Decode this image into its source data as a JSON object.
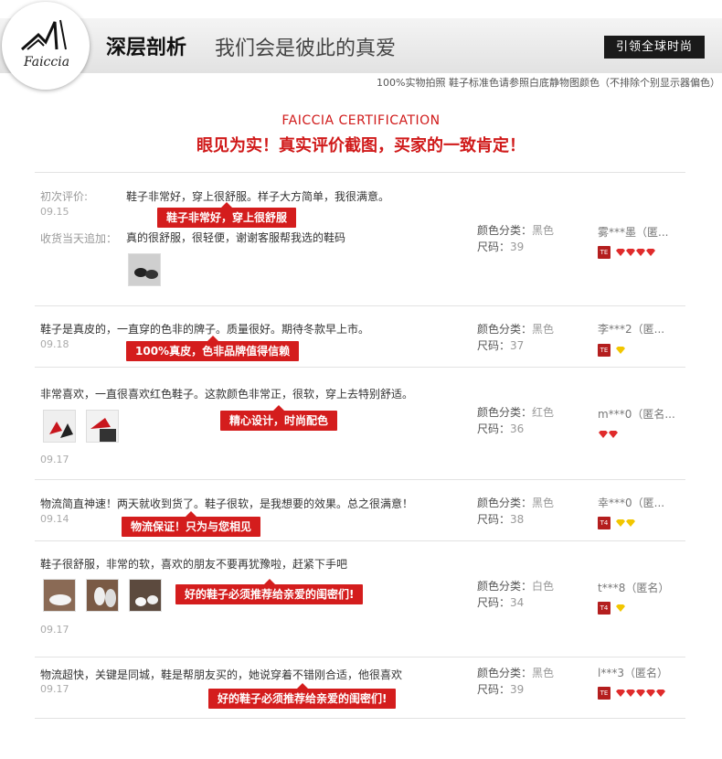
{
  "header": {
    "logo_text": "Faiccia",
    "title": "深层剖析",
    "subtitle": "我们会是彼此的真爱",
    "tag": "引领全球时尚",
    "disclaimer": "100%实物拍照 鞋子标准色请参照白底静物图颜色（不排除个别显示器偏色）"
  },
  "certification": {
    "english": "FAICCIA CERTIFICATION",
    "chinese": "眼见为实！真实评价截图，买家的一致肯定！"
  },
  "attr_labels": {
    "color": "颜色分类：",
    "size": "尺码："
  },
  "colors": {
    "accent_red": "#d41d1d",
    "level_badge": "#b41e1e"
  },
  "reviews": [
    {
      "first_label": "初次评价:",
      "text": "鞋子非常好，穿上很舒服。样子大方简单，我很满意。",
      "date": "09.15",
      "callout": "鞋子非常好，穿上很舒服",
      "followup_label": "收货当天追加：",
      "followup_text": "真的很舒服，很轻便，谢谢客服帮我选的鞋码",
      "color": "黑色",
      "size": "39",
      "user": "雾***墨（匿...",
      "level": "TE",
      "gems": 4
    },
    {
      "text": "鞋子是真皮的，一直穿的色非的牌子。质量很好。期待冬款早上市。",
      "date": "09.18",
      "callout": "100%真皮，色非品牌值得信赖",
      "color": "黑色",
      "size": "37",
      "user": "李***2（匿...",
      "level": "TE",
      "gems": 1
    },
    {
      "text": "非常喜欢，一直很喜欢红色鞋子。这款颜色非常正，很软，穿上去特别舒适。",
      "date": "09.17",
      "callout": "精心设计，时尚配色",
      "color": "红色",
      "size": "36",
      "user": "m***0（匿名...",
      "level": "",
      "gems": 2
    },
    {
      "text": "物流简直神速！两天就收到货了。鞋子很软，是我想要的效果。总之很满意！",
      "date": "09.14",
      "callout": "物流保证！只为与您相见",
      "color": "黑色",
      "size": "38",
      "user": "幸***0（匿...",
      "level": "T4",
      "gems": 2
    },
    {
      "text": "鞋子很舒服，非常的软，喜欢的朋友不要再犹豫啦，赶紧下手吧",
      "date": "09.17",
      "callout": "好的鞋子必须推荐给亲爱的闺密们!",
      "color": "白色",
      "size": "34",
      "user": "t***8（匿名）",
      "level": "T4",
      "gems": 1
    },
    {
      "text": "物流超快，关键是同城，鞋是帮朋友买的，她说穿着不错刚合适，他很喜欢",
      "date": "09.17",
      "callout": "好的鞋子必须推荐给亲爱的闺密们!",
      "color": "黑色",
      "size": "39",
      "user": "l***3（匿名）",
      "level": "TE",
      "gems": 5
    }
  ]
}
